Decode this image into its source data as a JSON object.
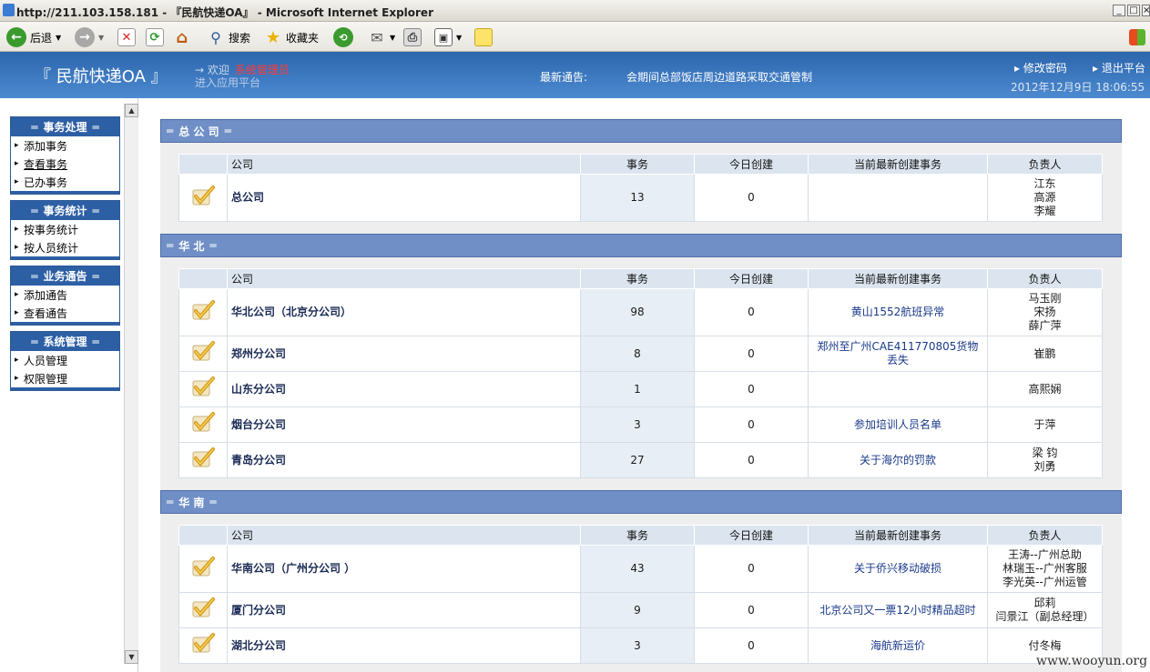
{
  "browser": {
    "title": "http://211.103.158.181 - 『民航快递OA』 - Microsoft Internet Explorer",
    "back": "后退",
    "search": "搜索",
    "favorites": "收藏夹"
  },
  "header": {
    "brand": "『 民航快递OA 』",
    "welcome": "→ 欢迎",
    "user": "系统管理员",
    "enter": "进入应用平台",
    "notice_label": "最新通告:",
    "notice": "会期间总部饭店周边道路采取交通管制",
    "change_pw": "修改密码",
    "logout": "退出平台",
    "datetime": "2012年12月9日  18:06:55"
  },
  "sidebar": [
    {
      "title": "事务处理",
      "items": [
        "添加事务",
        "查看事务",
        "已办事务"
      ]
    },
    {
      "title": "事务统计",
      "items": [
        "按事务统计",
        "按人员统计"
      ]
    },
    {
      "title": "业务通告",
      "items": [
        "添加通告",
        "查看通告"
      ]
    },
    {
      "title": "系统管理",
      "items": [
        "人员管理",
        "权限管理"
      ]
    }
  ],
  "columns": [
    "公司",
    "事务",
    "今日创建",
    "当前最新创建事务",
    "负责人"
  ],
  "sections": [
    {
      "title": "总 公 司",
      "rows": [
        {
          "name": "总公司",
          "count": "13",
          "today": "0",
          "latest": "",
          "owners": [
            "江东",
            "高源",
            "李耀"
          ]
        }
      ]
    },
    {
      "title": "华 北",
      "rows": [
        {
          "name": "华北公司（北京分公司）",
          "count": "98",
          "today": "0",
          "latest": "黄山1552航班异常",
          "owners": [
            "马玉刚",
            "宋扬",
            "薛广萍"
          ]
        },
        {
          "name": "郑州分公司",
          "count": "8",
          "today": "0",
          "latest": "郑州至广州CAE411770805货物丢失",
          "owners": [
            "崔鹏"
          ]
        },
        {
          "name": "山东分公司",
          "count": "1",
          "today": "0",
          "latest": "",
          "owners": [
            "高熙娴"
          ]
        },
        {
          "name": "烟台分公司",
          "count": "3",
          "today": "0",
          "latest": "参加培训人员名单",
          "owners": [
            "于萍"
          ]
        },
        {
          "name": "青岛分公司",
          "count": "27",
          "today": "0",
          "latest": "关于海尔的罚款",
          "owners": [
            "梁 钧",
            "刘勇"
          ]
        }
      ]
    },
    {
      "title": "华 南",
      "rows": [
        {
          "name": "华南公司（广州分公司 ）",
          "count": "43",
          "today": "0",
          "latest": "关于侨兴移动破损",
          "owners": [
            "王涛--广州总助",
            "林瑞玉--广州客服",
            "李光英--广州运管"
          ]
        },
        {
          "name": "厦门分公司",
          "count": "9",
          "today": "0",
          "latest": "北京公司又一票12小时精品超时",
          "owners": [
            "邱莉",
            "闫景江（副总经理）"
          ]
        },
        {
          "name": "湖北分公司",
          "count": "3",
          "today": "0",
          "latest": "海航新运价",
          "owners": [
            "付冬梅"
          ]
        }
      ]
    }
  ],
  "watermark": "www.wooyun.org"
}
